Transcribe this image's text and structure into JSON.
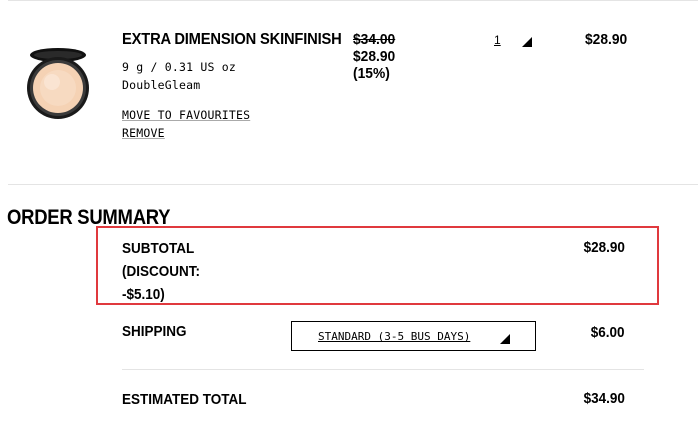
{
  "product": {
    "name": "EXTRA DIMENSION SKINFINISH",
    "size": "9 g / 0.31 US oz",
    "shade": "DoubleGleam",
    "move_label": "MOVE TO FAVOURITES",
    "remove_label": "REMOVE",
    "original_price": "$34.00",
    "sale_price": "$28.90",
    "discount_pct": "(15%)",
    "quantity": "1",
    "line_total": "$28.90"
  },
  "summary": {
    "title": "ORDER SUMMARY",
    "subtotal_label": "SUBTOTAL",
    "discount_label_1": "(DISCOUNT:",
    "discount_label_2": "-$5.10)",
    "subtotal_value": "$28.90",
    "shipping_label": "SHIPPING",
    "shipping_option": "STANDARD (3-5 BUS DAYS)",
    "shipping_value": "$6.00",
    "total_label": "ESTIMATED TOTAL",
    "total_value": "$34.90"
  },
  "colors": {
    "highlight": "#e0393e",
    "divider": "#e4e4e4"
  }
}
